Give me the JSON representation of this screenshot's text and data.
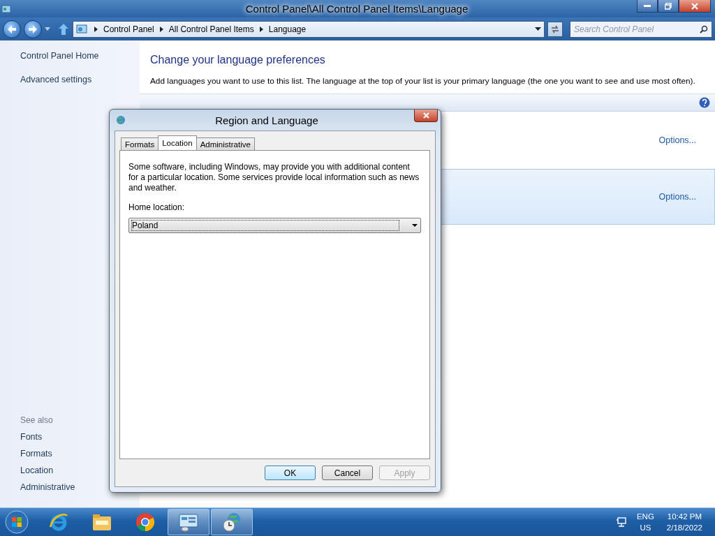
{
  "window": {
    "title": "Control Panel\\All Control Panel Items\\Language"
  },
  "address_bar": {
    "breadcrumbs": [
      "Control Panel",
      "All Control Panel Items",
      "Language"
    ]
  },
  "search": {
    "placeholder": "Search Control Panel"
  },
  "sidebar": {
    "items": [
      "Control Panel Home",
      "Advanced settings"
    ],
    "see_also_title": "See also",
    "see_also": [
      "Fonts",
      "Formats",
      "Location",
      "Administrative"
    ]
  },
  "main": {
    "heading": "Change your language preferences",
    "description": "Add languages you want to use to this list. The language at the top of your list is your primary language (the one you want to see and use most often).",
    "languages": [
      {
        "selected": false,
        "options_link": "Options..."
      },
      {
        "selected": true,
        "options_link": "Options..."
      }
    ]
  },
  "dialog": {
    "title": "Region and Language",
    "tabs": [
      {
        "label": "Formats",
        "selected": false
      },
      {
        "label": "Location",
        "selected": true
      },
      {
        "label": "Administrative",
        "selected": false
      }
    ],
    "description": "Some software, including Windows, may provide you with additional content for a particular location. Some services provide local information such as news and weather.",
    "home_location_label": "Home location:",
    "home_location_value": "Poland",
    "buttons": [
      {
        "label": "OK",
        "default": true,
        "disabled": false
      },
      {
        "label": "Cancel",
        "default": false,
        "disabled": false
      },
      {
        "label": "Apply",
        "default": false,
        "disabled": true
      }
    ]
  },
  "taskbar": {
    "apps": [
      {
        "kind": "ie",
        "active": false
      },
      {
        "kind": "explorer",
        "active": false
      },
      {
        "kind": "chrome",
        "active": false
      },
      {
        "kind": "control-panel",
        "active": true
      },
      {
        "kind": "region",
        "active": true
      }
    ],
    "language": "ENG",
    "region": "US",
    "time": "10:42 PM",
    "date": "2/18/2022"
  }
}
